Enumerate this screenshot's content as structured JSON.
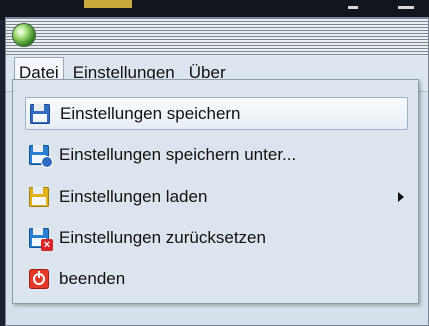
{
  "menubar": {
    "items": [
      {
        "label": "Datei"
      },
      {
        "label": "Einstellungen"
      },
      {
        "label": "Über"
      }
    ]
  },
  "dropdown": {
    "items": [
      {
        "label": "Einstellungen speichern",
        "icon": "floppy-save-icon"
      },
      {
        "label": "Einstellungen speichern unter...",
        "icon": "floppy-save-as-icon"
      },
      {
        "label": "Einstellungen laden",
        "icon": "floppy-load-icon"
      },
      {
        "label": "Einstellungen zurücksetzen",
        "icon": "reset-icon"
      },
      {
        "label": "beenden",
        "icon": "power-icon"
      }
    ]
  }
}
